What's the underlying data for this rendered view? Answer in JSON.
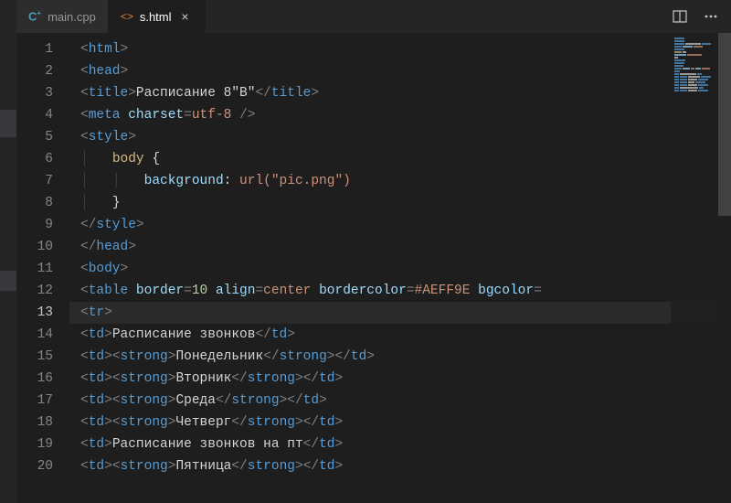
{
  "tabs": [
    {
      "label": "main.cpp",
      "active": false,
      "iconType": "cpp"
    },
    {
      "label": "s.html",
      "active": true,
      "iconType": "html"
    }
  ],
  "activeLine": 13,
  "code_lines": [
    {
      "n": 1,
      "tokens": [
        [
          "pun",
          "<"
        ],
        [
          "tag",
          "html"
        ],
        [
          "pun",
          ">"
        ]
      ]
    },
    {
      "n": 2,
      "tokens": [
        [
          "pun",
          "<"
        ],
        [
          "tag",
          "head"
        ],
        [
          "pun",
          ">"
        ]
      ]
    },
    {
      "n": 3,
      "tokens": [
        [
          "pun",
          "<"
        ],
        [
          "tag",
          "title"
        ],
        [
          "pun",
          ">"
        ],
        [
          "txt",
          "Расписание 8\"В\""
        ],
        [
          "pun",
          "</"
        ],
        [
          "tag",
          "title"
        ],
        [
          "pun",
          ">"
        ]
      ]
    },
    {
      "n": 4,
      "tokens": [
        [
          "pun",
          "<"
        ],
        [
          "tag",
          "meta"
        ],
        [
          "txt",
          " "
        ],
        [
          "attr",
          "charset"
        ],
        [
          "pun",
          "="
        ],
        [
          "str",
          "utf-8"
        ],
        [
          "txt",
          " "
        ],
        [
          "pun",
          "/>"
        ]
      ]
    },
    {
      "n": 5,
      "tokens": [
        [
          "pun",
          "<"
        ],
        [
          "tag",
          "style"
        ],
        [
          "pun",
          ">"
        ]
      ]
    },
    {
      "n": 6,
      "tokens": [
        [
          "guide",
          "│   "
        ],
        [
          "sel",
          "body"
        ],
        [
          "txt",
          " "
        ],
        [
          "brace",
          "{"
        ]
      ]
    },
    {
      "n": 7,
      "tokens": [
        [
          "guide",
          "│   │   "
        ],
        [
          "prop",
          "background"
        ],
        [
          "txt",
          ": "
        ],
        [
          "val",
          "url(\"pic.png\")"
        ]
      ]
    },
    {
      "n": 8,
      "tokens": [
        [
          "guide",
          "│   "
        ],
        [
          "brace",
          "}"
        ]
      ]
    },
    {
      "n": 9,
      "tokens": [
        [
          "pun",
          "</"
        ],
        [
          "tag",
          "style"
        ],
        [
          "pun",
          ">"
        ]
      ]
    },
    {
      "n": 10,
      "tokens": [
        [
          "pun",
          "</"
        ],
        [
          "tag",
          "head"
        ],
        [
          "pun",
          ">"
        ]
      ]
    },
    {
      "n": 11,
      "tokens": [
        [
          "pun",
          "<"
        ],
        [
          "tag",
          "body"
        ],
        [
          "pun",
          ">"
        ]
      ]
    },
    {
      "n": 12,
      "tokens": [
        [
          "pun",
          "<"
        ],
        [
          "tag",
          "table"
        ],
        [
          "txt",
          " "
        ],
        [
          "attr",
          "border"
        ],
        [
          "pun",
          "="
        ],
        [
          "num",
          "10"
        ],
        [
          "txt",
          " "
        ],
        [
          "attr",
          "align"
        ],
        [
          "pun",
          "="
        ],
        [
          "str",
          "center"
        ],
        [
          "txt",
          " "
        ],
        [
          "attr",
          "bordercolor"
        ],
        [
          "pun",
          "="
        ],
        [
          "str",
          "#AEFF9E"
        ],
        [
          "txt",
          " "
        ],
        [
          "attr",
          "bgcolor"
        ],
        [
          "pun",
          "="
        ]
      ]
    },
    {
      "n": 13,
      "tokens": [
        [
          "pun",
          "<"
        ],
        [
          "tag",
          "tr"
        ],
        [
          "pun",
          ">"
        ]
      ]
    },
    {
      "n": 14,
      "tokens": [
        [
          "pun",
          "<"
        ],
        [
          "tag",
          "td"
        ],
        [
          "pun",
          ">"
        ],
        [
          "txt",
          "Расписание звонков"
        ],
        [
          "pun",
          "</"
        ],
        [
          "tag",
          "td"
        ],
        [
          "pun",
          ">"
        ]
      ]
    },
    {
      "n": 15,
      "tokens": [
        [
          "pun",
          "<"
        ],
        [
          "tag",
          "td"
        ],
        [
          "pun",
          ">"
        ],
        [
          "pun",
          "<"
        ],
        [
          "tag",
          "strong"
        ],
        [
          "pun",
          ">"
        ],
        [
          "txt",
          "Понедельник"
        ],
        [
          "pun",
          "</"
        ],
        [
          "tag",
          "strong"
        ],
        [
          "pun",
          ">"
        ],
        [
          "pun",
          "</"
        ],
        [
          "tag",
          "td"
        ],
        [
          "pun",
          ">"
        ]
      ]
    },
    {
      "n": 16,
      "tokens": [
        [
          "pun",
          "<"
        ],
        [
          "tag",
          "td"
        ],
        [
          "pun",
          ">"
        ],
        [
          "pun",
          "<"
        ],
        [
          "tag",
          "strong"
        ],
        [
          "pun",
          ">"
        ],
        [
          "txt",
          "Вторник"
        ],
        [
          "pun",
          "</"
        ],
        [
          "tag",
          "strong"
        ],
        [
          "pun",
          ">"
        ],
        [
          "pun",
          "</"
        ],
        [
          "tag",
          "td"
        ],
        [
          "pun",
          ">"
        ]
      ]
    },
    {
      "n": 17,
      "tokens": [
        [
          "pun",
          "<"
        ],
        [
          "tag",
          "td"
        ],
        [
          "pun",
          ">"
        ],
        [
          "pun",
          "<"
        ],
        [
          "tag",
          "strong"
        ],
        [
          "pun",
          ">"
        ],
        [
          "txt",
          "Среда"
        ],
        [
          "pun",
          "</"
        ],
        [
          "tag",
          "strong"
        ],
        [
          "pun",
          ">"
        ],
        [
          "pun",
          "</"
        ],
        [
          "tag",
          "td"
        ],
        [
          "pun",
          ">"
        ]
      ]
    },
    {
      "n": 18,
      "tokens": [
        [
          "pun",
          "<"
        ],
        [
          "tag",
          "td"
        ],
        [
          "pun",
          ">"
        ],
        [
          "pun",
          "<"
        ],
        [
          "tag",
          "strong"
        ],
        [
          "pun",
          ">"
        ],
        [
          "txt",
          "Четверг"
        ],
        [
          "pun",
          "</"
        ],
        [
          "tag",
          "strong"
        ],
        [
          "pun",
          ">"
        ],
        [
          "pun",
          "</"
        ],
        [
          "tag",
          "td"
        ],
        [
          "pun",
          ">"
        ]
      ]
    },
    {
      "n": 19,
      "tokens": [
        [
          "pun",
          "<"
        ],
        [
          "tag",
          "td"
        ],
        [
          "pun",
          ">"
        ],
        [
          "txt",
          "Расписание звонков на пт"
        ],
        [
          "pun",
          "</"
        ],
        [
          "tag",
          "td"
        ],
        [
          "pun",
          ">"
        ]
      ]
    },
    {
      "n": 20,
      "tokens": [
        [
          "pun",
          "<"
        ],
        [
          "tag",
          "td"
        ],
        [
          "pun",
          ">"
        ],
        [
          "pun",
          "<"
        ],
        [
          "tag",
          "strong"
        ],
        [
          "pun",
          ">"
        ],
        [
          "txt",
          "Пятница"
        ],
        [
          "pun",
          "</"
        ],
        [
          "tag",
          "strong"
        ],
        [
          "pun",
          ">"
        ],
        [
          "pun",
          "</"
        ],
        [
          "tag",
          "td"
        ],
        [
          "pun",
          ">"
        ]
      ]
    }
  ],
  "minimap_rows": [
    [
      [
        "#569cd6",
        18
      ]
    ],
    [
      [
        "#569cd6",
        18
      ]
    ],
    [
      [
        "#569cd6",
        18
      ],
      [
        "#d4d4d4",
        28
      ],
      [
        "#569cd6",
        18
      ]
    ],
    [
      [
        "#569cd6",
        14
      ],
      [
        "#9cdcfe",
        18
      ],
      [
        "#ce9178",
        16
      ]
    ],
    [
      [
        "#569cd6",
        18
      ]
    ],
    [
      [
        "#d7ba7d",
        14
      ],
      [
        "#d4d4d4",
        6
      ]
    ],
    [
      [
        "#9cdcfe",
        22
      ],
      [
        "#ce9178",
        26
      ]
    ],
    [
      [
        "#d4d4d4",
        6
      ]
    ],
    [
      [
        "#569cd6",
        20
      ]
    ],
    [
      [
        "#569cd6",
        18
      ]
    ],
    [
      [
        "#569cd6",
        16
      ]
    ],
    [
      [
        "#569cd6",
        14
      ],
      [
        "#9cdcfe",
        12
      ],
      [
        "#ce9178",
        8
      ],
      [
        "#9cdcfe",
        10
      ],
      [
        "#ce9178",
        14
      ]
    ],
    [
      [
        "#569cd6",
        10
      ]
    ],
    [
      [
        "#569cd6",
        8
      ],
      [
        "#d4d4d4",
        30
      ],
      [
        "#569cd6",
        8
      ]
    ],
    [
      [
        "#569cd6",
        8
      ],
      [
        "#569cd6",
        14
      ],
      [
        "#d4d4d4",
        22
      ],
      [
        "#569cd6",
        18
      ]
    ],
    [
      [
        "#569cd6",
        8
      ],
      [
        "#569cd6",
        14
      ],
      [
        "#d4d4d4",
        16
      ],
      [
        "#569cd6",
        18
      ]
    ],
    [
      [
        "#569cd6",
        8
      ],
      [
        "#569cd6",
        14
      ],
      [
        "#d4d4d4",
        12
      ],
      [
        "#569cd6",
        18
      ]
    ],
    [
      [
        "#569cd6",
        8
      ],
      [
        "#569cd6",
        14
      ],
      [
        "#d4d4d4",
        16
      ],
      [
        "#569cd6",
        18
      ]
    ],
    [
      [
        "#569cd6",
        8
      ],
      [
        "#d4d4d4",
        34
      ],
      [
        "#569cd6",
        8
      ]
    ],
    [
      [
        "#569cd6",
        8
      ],
      [
        "#569cd6",
        14
      ],
      [
        "#d4d4d4",
        16
      ],
      [
        "#569cd6",
        18
      ]
    ]
  ]
}
